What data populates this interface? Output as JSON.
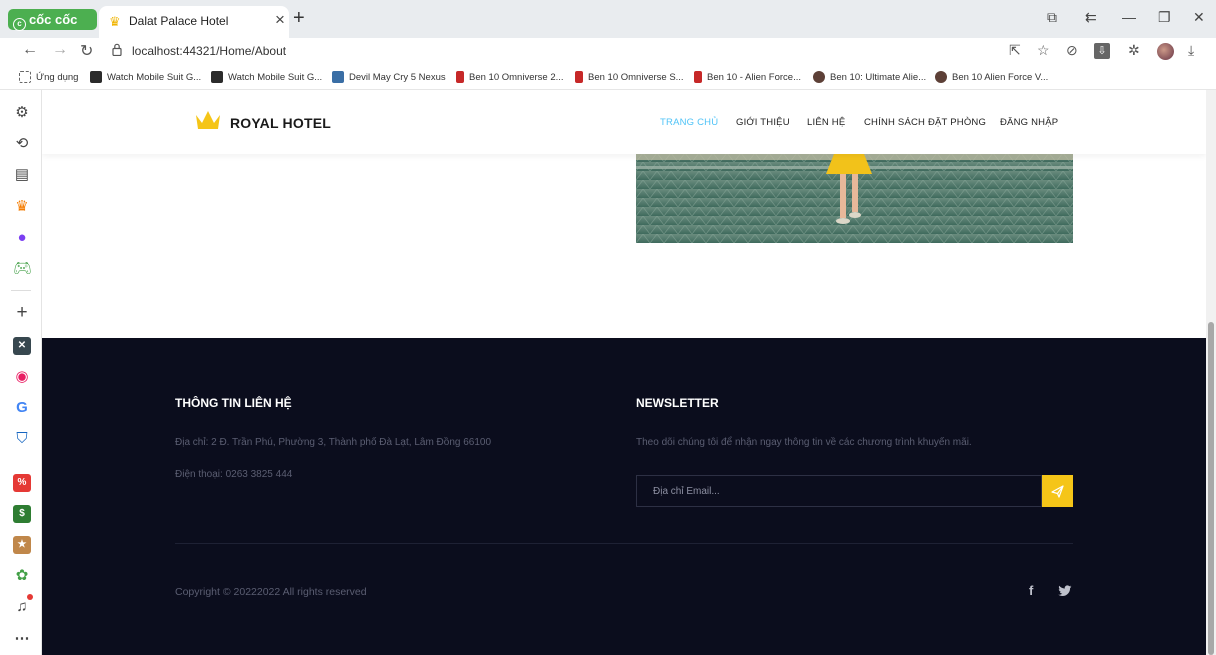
{
  "browser": {
    "brand_label": "cốc cốc",
    "tab_title": "Dalat Palace Hotel",
    "url": "localhost:44321/Home/About",
    "bookmarks": [
      {
        "label": "Ứng dụng",
        "color": "#666666"
      },
      {
        "label": "Watch Mobile Suit G...",
        "color": "#2b2b2b"
      },
      {
        "label": "Watch Mobile Suit G...",
        "color": "#2b2b2b"
      },
      {
        "label": "Devil May Cry 5 Nexus",
        "color": "#3a6ea5"
      },
      {
        "label": "Ben 10 Omniverse 2...",
        "color": "#c62828"
      },
      {
        "label": "Ben 10 Omniverse S...",
        "color": "#c62828"
      },
      {
        "label": "Ben 10 - Alien Force...",
        "color": "#c62828"
      },
      {
        "label": "Ben 10: Ultimate Alie...",
        "color": "#5d4037"
      },
      {
        "label": "Ben 10 Alien Force V...",
        "color": "#5d4037"
      }
    ]
  },
  "site": {
    "logo_text": "ROYAL HOTEL",
    "accent_color": "#f5c518",
    "menu": [
      "TRANG CHỦ",
      "GIỚI THIỆU",
      "LIÊN HỆ",
      "CHÍNH SÁCH ĐẶT PHÒNG",
      "ĐĂNG NHẬP"
    ]
  },
  "footer": {
    "contact_title": "THÔNG TIN LIÊN HỆ",
    "address": "Địa chỉ: 2 Đ. Trần Phú, Phường 3, Thành phố Đà Lạt, Lâm Đồng 66100",
    "phone": "Điện thoại: 0263 3825 444",
    "newsletter_title": "NEWSLETTER",
    "newsletter_text": "Theo dõi chúng tôi để nhận ngay thông tin về các chương trình khuyến mãi.",
    "email_placeholder": "Địa chỉ Email...",
    "copyright": "Copyright © 20222022 All rights reserved"
  }
}
